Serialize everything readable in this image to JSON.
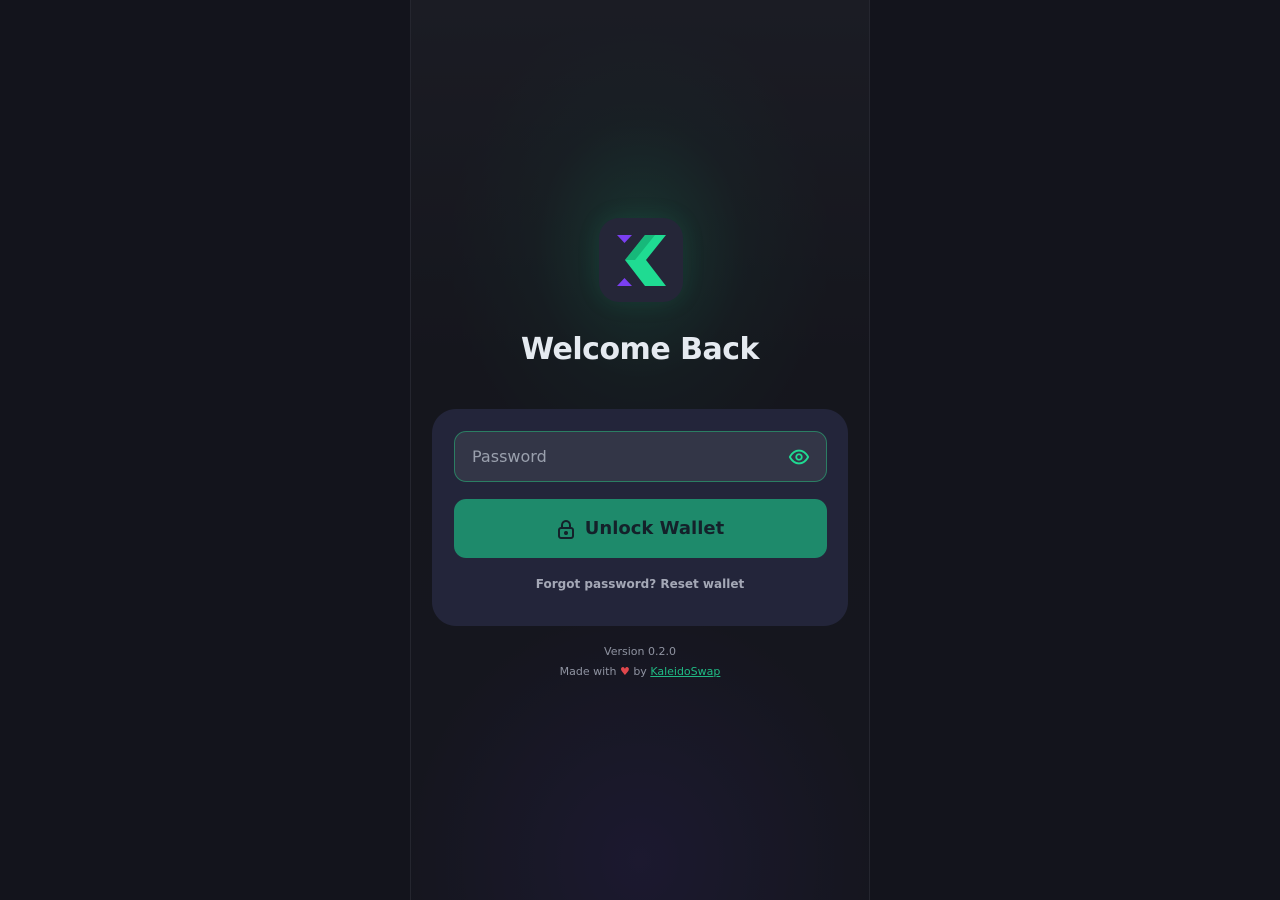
{
  "login": {
    "title": "Welcome Back",
    "password_placeholder": "Password",
    "password_value": "",
    "unlock_label": "Unlock Wallet",
    "forgot_text": "Forgot password? Reset wallet"
  },
  "footer": {
    "version": "Version 0.2.0",
    "made_with": "Made with",
    "heart": "♥",
    "by": "by",
    "brand_link": "KaleidoSwap"
  },
  "icons": {
    "logo": "kaleidoswap-logo-icon",
    "password_toggle": "eye-icon",
    "unlock": "lock-icon"
  },
  "colors": {
    "accent": "#1e8a6b",
    "accent_bright": "#1fdb92",
    "logo_purple": "#7b3ff2",
    "card_bg": "#23253a",
    "background": "#13141c",
    "heart": "#e0474c"
  }
}
